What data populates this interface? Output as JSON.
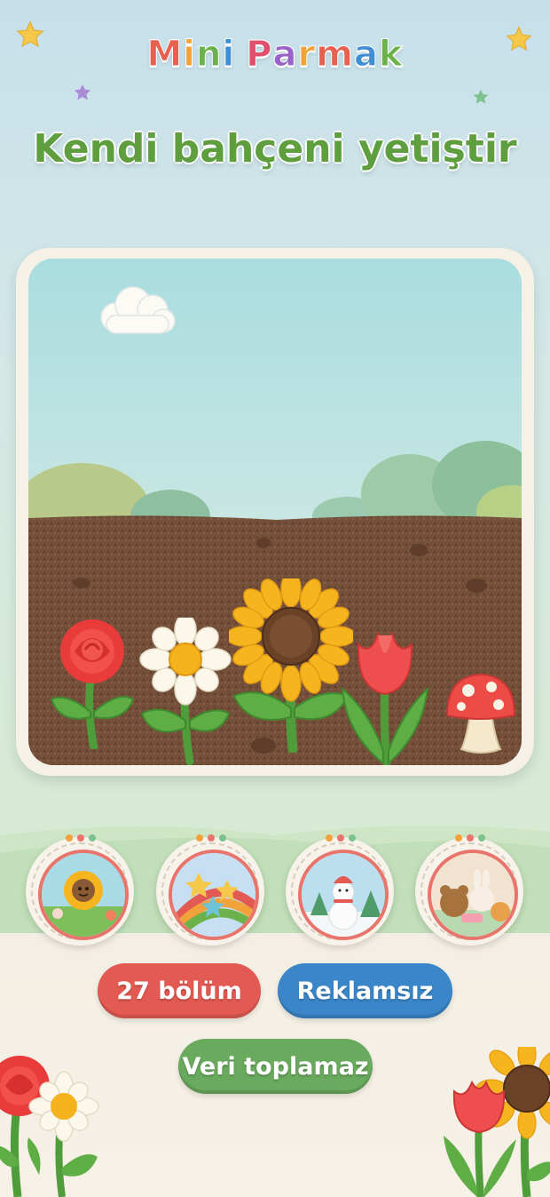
{
  "app": {
    "brand_letters": [
      "M",
      "i",
      "n",
      "i",
      " ",
      "P",
      "a",
      "r",
      "m",
      "a",
      "k"
    ],
    "brand_colors": [
      "#e8604f",
      "#f2a23a",
      "#6cb24a",
      "#3e8ed6",
      "#ffffff",
      "#e0506c",
      "#9a62c9",
      "#f2a23a",
      "#e8604f",
      "#3e8ed6",
      "#6cb24a"
    ],
    "headline": "Kendi bahçeni yetiştir"
  },
  "colors": {
    "headline": "#5f9e3f",
    "chip_episodes": "#e35a52",
    "chip_no_ads": "#3a86c8",
    "chip_privacy": "#6aaa5e",
    "badge_ring": "#e8746b"
  },
  "hero": {
    "icons": [
      "cloud-icon",
      "rose-icon",
      "daisy-icon",
      "sunflower-icon",
      "tulip-icon",
      "mushroom-icon"
    ]
  },
  "badges": [
    {
      "name": "sunflower-garden-badge"
    },
    {
      "name": "rainbow-stars-badge"
    },
    {
      "name": "snowman-badge"
    },
    {
      "name": "animal-friends-badge"
    }
  ],
  "chips": {
    "episodes": "27 bölüm",
    "no_ads": "Reklamsız",
    "privacy": "Veri toplamaz"
  }
}
